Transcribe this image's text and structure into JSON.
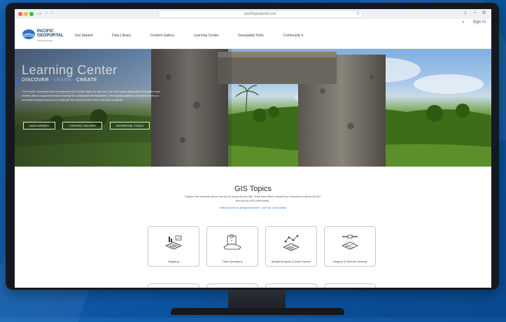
{
  "browser": {
    "url": "pacificgeoportal.com"
  },
  "header": {
    "logo_line1": "PACIFIC",
    "logo_line2": "GEOPORTAL",
    "logo_sub": "Powered by Esri",
    "sign_in": "Sign In",
    "nav": [
      "Get Started",
      "Data Library",
      "Content Gallery",
      "Learning Center",
      "Geospatial Tools",
      "Community ▾"
    ]
  },
  "hero": {
    "title": "Learning Center",
    "tag_part1": "DISCOVER · ",
    "tag_part2": "LEARN",
    "tag_part3": " · CREATE",
    "description": "The Pacific Geoportal aims to empower the Pacific region to discover, use and share geospatial information and related data to support decision making for sustainable development. This regional platform provides access to essential training resources to help get the most from the tools and data available.",
    "buttons": [
      "DATA LIBRARY",
      "CONTENT GALLERY",
      "GEOSPATIAL TOOLS"
    ]
  },
  "topics": {
    "title": "GIS Topics",
    "description": "Explore the tutorials below and try as many as you like. They have been created by curriculum experts at Esri and by the GIS community.",
    "link": "Need access to geospatial tools? Join our community!",
    "cards": [
      {
        "label": "Mapping",
        "icon": "mapping-icon"
      },
      {
        "label": "Field Operations",
        "icon": "field-operations-icon"
      },
      {
        "label": "Spatial Analysis & Data Science",
        "icon": "spatial-analysis-icon"
      },
      {
        "label": "Imagery & Remote Sensing",
        "icon": "imagery-icon"
      }
    ]
  },
  "colors": {
    "accent": "#1e73d6",
    "background": "#1565b8"
  }
}
